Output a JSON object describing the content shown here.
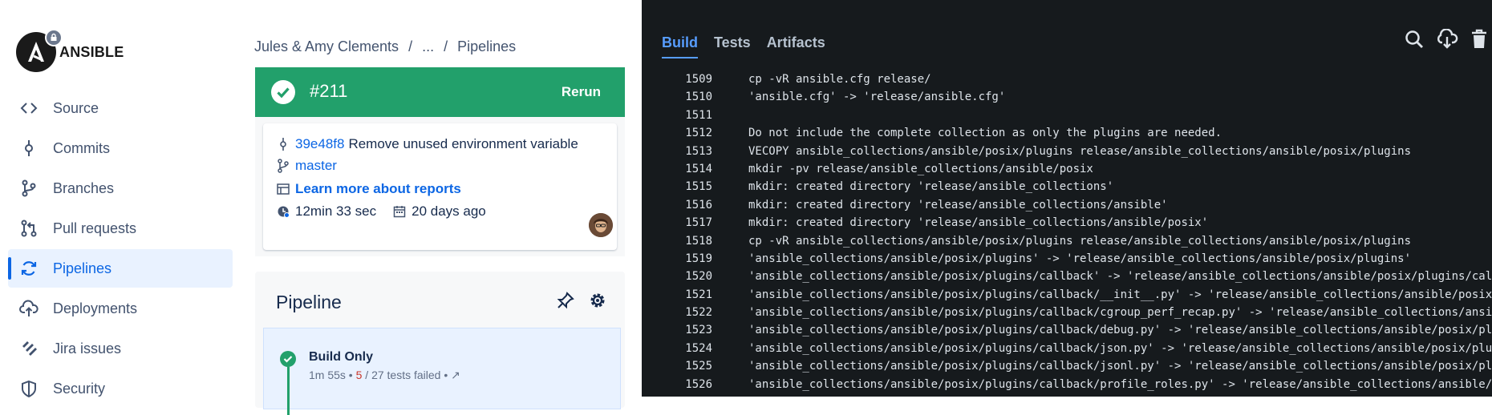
{
  "sidebar": {
    "logo_text": "ANSIBLE",
    "items": [
      {
        "label": "Source",
        "icon": "code-icon"
      },
      {
        "label": "Commits",
        "icon": "commit-icon"
      },
      {
        "label": "Branches",
        "icon": "branch-icon"
      },
      {
        "label": "Pull requests",
        "icon": "pull-request-icon"
      },
      {
        "label": "Pipelines",
        "icon": "pipelines-icon",
        "active": true
      },
      {
        "label": "Deployments",
        "icon": "cloud-upload-icon"
      },
      {
        "label": "Jira issues",
        "icon": "jira-icon"
      },
      {
        "label": "Security",
        "icon": "shield-icon"
      }
    ]
  },
  "breadcrumb": {
    "owner": "Jules & Amy Clements",
    "ellipsis": "...",
    "current": "Pipelines"
  },
  "status": {
    "number": "#211",
    "rerun_label": "Rerun",
    "color": "#22a06b"
  },
  "info": {
    "commit_hash": "39e48f8",
    "commit_message": "Remove unused environment variable",
    "branch": "master",
    "reports_link": "Learn more about reports",
    "duration": "12min 33 sec",
    "age": "20 days ago"
  },
  "pipeline": {
    "title": "Pipeline",
    "step": {
      "name": "Build Only",
      "duration": "1m 55s",
      "failed": "5",
      "total": "/ 27 tests failed"
    }
  },
  "log": {
    "tabs": [
      "Build",
      "Tests",
      "Artifacts"
    ],
    "active_tab": "Build",
    "lines": [
      {
        "n": "1509",
        "t": "cp -vR ansible.cfg release/"
      },
      {
        "n": "1510",
        "t": "'ansible.cfg' -> 'release/ansible.cfg'"
      },
      {
        "n": "1511",
        "t": ""
      },
      {
        "n": "1512",
        "t": "Do not include the complete collection as only the plugins are needed."
      },
      {
        "n": "1513",
        "t": "VECOPY ansible_collections/ansible/posix/plugins release/ansible_collections/ansible/posix/plugins"
      },
      {
        "n": "1514",
        "t": "mkdir -pv release/ansible_collections/ansible/posix"
      },
      {
        "n": "1515",
        "t": "mkdir: created directory 'release/ansible_collections'"
      },
      {
        "n": "1516",
        "t": "mkdir: created directory 'release/ansible_collections/ansible'"
      },
      {
        "n": "1517",
        "t": "mkdir: created directory 'release/ansible_collections/ansible/posix'"
      },
      {
        "n": "1518",
        "t": "cp -vR ansible_collections/ansible/posix/plugins release/ansible_collections/ansible/posix/plugins"
      },
      {
        "n": "1519",
        "t": "'ansible_collections/ansible/posix/plugins' -> 'release/ansible_collections/ansible/posix/plugins'"
      },
      {
        "n": "1520",
        "t": "'ansible_collections/ansible/posix/plugins/callback' -> 'release/ansible_collections/ansible/posix/plugins/callba"
      },
      {
        "n": "1521",
        "t": "'ansible_collections/ansible/posix/plugins/callback/__init__.py' -> 'release/ansible_collections/ansible/posix/pl"
      },
      {
        "n": "1522",
        "t": "'ansible_collections/ansible/posix/plugins/callback/cgroup_perf_recap.py' -> 'release/ansible_collections/ansible"
      },
      {
        "n": "1523",
        "t": "'ansible_collections/ansible/posix/plugins/callback/debug.py' -> 'release/ansible_collections/ansible/posix/plugi"
      },
      {
        "n": "1524",
        "t": "'ansible_collections/ansible/posix/plugins/callback/json.py' -> 'release/ansible_collections/ansible/posix/plugin"
      },
      {
        "n": "1525",
        "t": "'ansible_collections/ansible/posix/plugins/callback/jsonl.py' -> 'release/ansible_collections/ansible/posix/plugi"
      },
      {
        "n": "1526",
        "t": "'ansible_collections/ansible/posix/plugins/callback/profile_roles.py' -> 'release/ansible_collections/ansible/pos"
      }
    ]
  }
}
